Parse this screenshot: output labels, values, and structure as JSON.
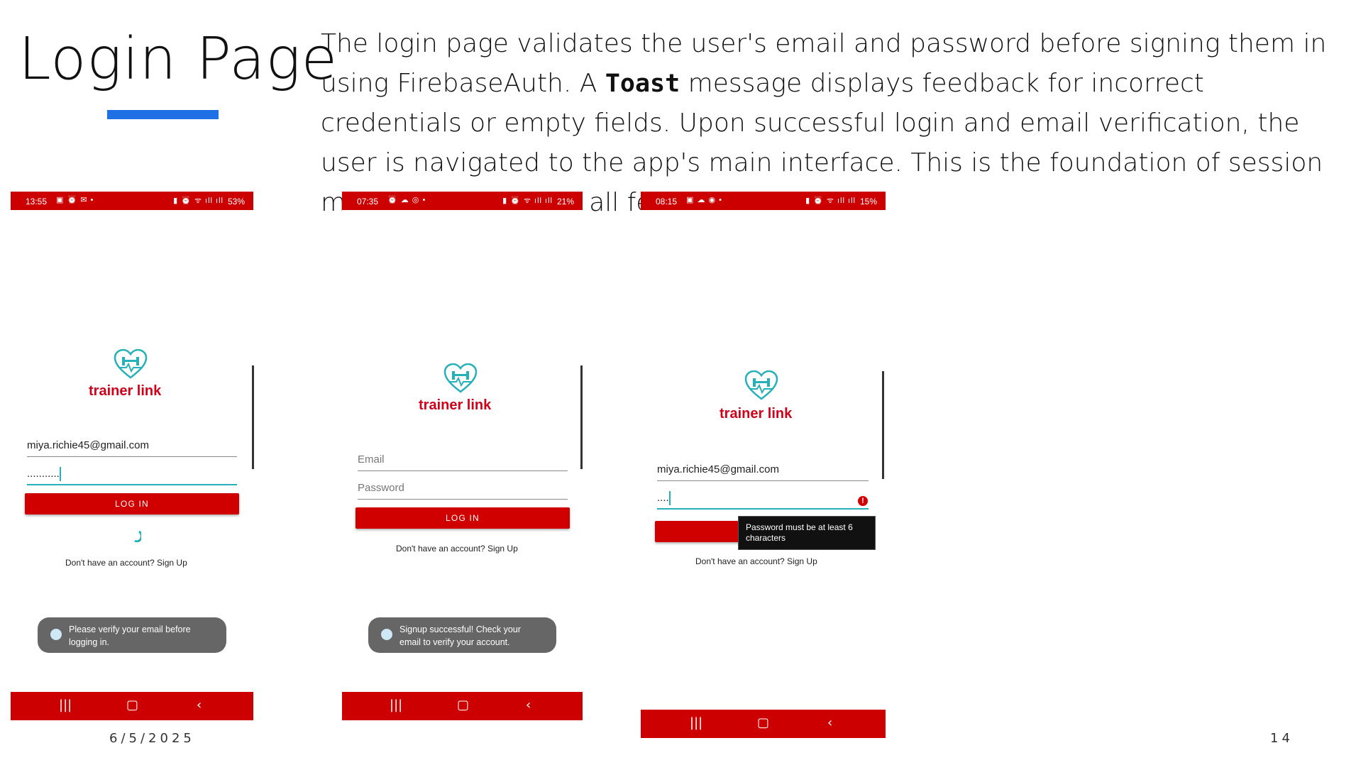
{
  "slide": {
    "title": "Login Page",
    "description_before": "The login page validates the user's email and password before signing them in using FirebaseAuth. A ",
    "description_code": "Toast",
    "description_after": " message displays feedback for incorrect credentials or empty fields. Upon successful login and email verification, the user is navigated to the app's main interface. This is the foundation of session management across all features.",
    "date": "6/5/2025",
    "page_number": "14",
    "accent_color": "#1f6fe5"
  },
  "phones": [
    {
      "status_time": "13:55",
      "battery": "53%",
      "brand": "trainer link",
      "email_value": "miya.richie45@gmail.com",
      "password_value": "...........",
      "login_label": "LOG IN",
      "signup_text": "Don't have an account? Sign Up",
      "toast_text_line1": "Please verify your email before",
      "toast_text_line2": "logging in."
    },
    {
      "status_time": "07:35",
      "battery": "21%",
      "brand": "trainer link",
      "email_placeholder": "Email",
      "password_placeholder": "Password",
      "login_label": "LOG IN",
      "signup_text": "Don't have an account? Sign Up",
      "toast_text_line1": "Signup successful! Check your",
      "toast_text_line2": "email to verify your account."
    },
    {
      "status_time": "08:15",
      "battery": "15%",
      "brand": "trainer link",
      "email_value": "miya.richie45@gmail.com",
      "password_value": "....",
      "signup_text": "Don't have an account? Sign Up",
      "error_line1": "Password must be at least 6",
      "error_line2": "characters"
    }
  ],
  "colors": {
    "app_red": "#cc0000",
    "brand_red": "#d0021b",
    "teal": "#26b0b8"
  }
}
